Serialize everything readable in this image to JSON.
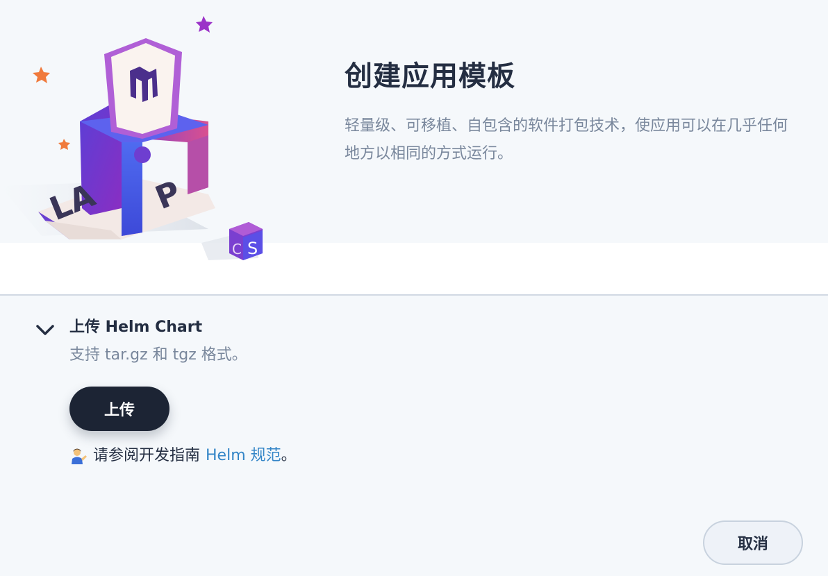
{
  "header": {
    "title": "创建应用模板",
    "description": "轻量级、可移植、自包含的软件打包技术，使应用可以在几乎任何地方以相同的方式运行。",
    "illustration": {
      "name": "app-template-illustration",
      "sign_text": "LAMP",
      "cube_text": "CS"
    }
  },
  "upload_section": {
    "title": "上传 Helm Chart",
    "description": "支持 tar.gz 和 tgz 格式。",
    "upload_label": "上传",
    "guide_prefix": "请参阅开发指南",
    "guide_link": "Helm 规范",
    "guide_suffix": "。",
    "guide_icon": "person-tipping-hand-icon"
  },
  "footer": {
    "cancel_label": "取消"
  },
  "colors": {
    "header_bg": "#f5f8fb",
    "primary_dark": "#1c2434",
    "link": "#3385c7",
    "muted_text": "#79879c"
  }
}
